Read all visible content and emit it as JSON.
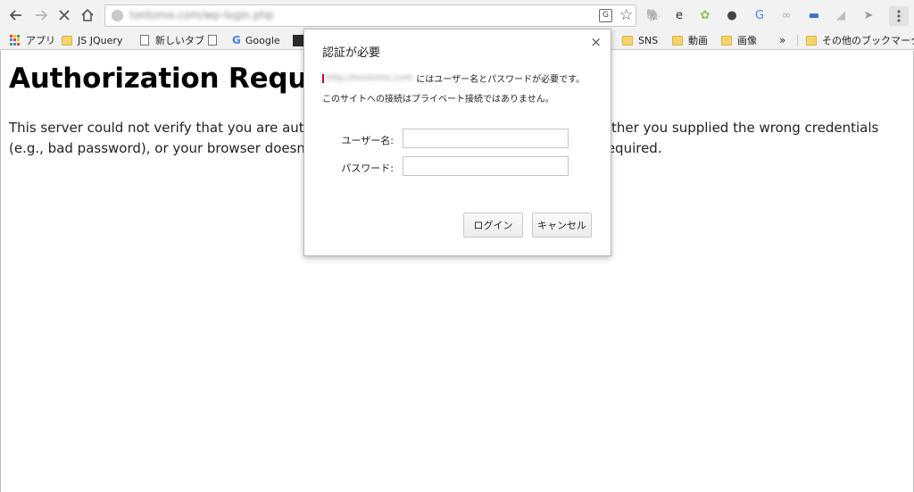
{
  "browser": {
    "url": "tontomo.com/wp-login.php",
    "colors": {
      "toolbar": "#f2f2f2",
      "folder": "#f6d36b"
    },
    "icons": [
      "back-icon",
      "forward-icon",
      "stop-icon",
      "home-icon",
      "translate-icon",
      "star-icon",
      "menu-icon"
    ],
    "translate_glyph": "G",
    "extensions": [
      {
        "name": "evernote-icon",
        "glyph": "🐘",
        "color": "#3a3a3a"
      },
      {
        "name": "e-icon",
        "glyph": "e",
        "color": "#2b2b2b"
      },
      {
        "name": "android-icon",
        "glyph": "✿",
        "color": "#8bc34a"
      },
      {
        "name": "bulb-icon",
        "glyph": "●",
        "color": "#444"
      },
      {
        "name": "google-translate-icon",
        "glyph": "G",
        "color": "#4285f4"
      },
      {
        "name": "link-icon",
        "glyph": "∞",
        "color": "#b0b0b0"
      },
      {
        "name": "chat-icon",
        "glyph": "▬",
        "color": "#3b6fd6"
      },
      {
        "name": "rss-icon",
        "glyph": "◢",
        "color": "#bdbdbd"
      },
      {
        "name": "cursor-icon",
        "glyph": "➤",
        "color": "#9a9a9a"
      }
    ]
  },
  "bookmarks": {
    "apps": "アプリ",
    "jsjquery": "JS JQuery",
    "newtab": "新しいタブ",
    "google": "Google",
    "sns": "SNS",
    "douga": "動画",
    "gazou": "画像",
    "overflow": "»",
    "other": "その他のブックマーク"
  },
  "page": {
    "title": "Authorization Required",
    "body": "This server could not verify that you are authorized to access the document requested. Either you supplied the wrong credentials (e.g., bad password), or your browser doesn't understand how to supply the credentials required."
  },
  "dialog": {
    "title": "認証が必要",
    "close": "×",
    "site": "http://tontomo.com",
    "message1": "にはユーザー名とパスワードが必要です。",
    "message2": "このサイトへの接続はプライベート接続ではありません。",
    "username_label": "ユーザー名:",
    "username_value": "",
    "password_label": "パスワード:",
    "password_value": "",
    "login_button": "ログイン",
    "cancel_button": "キャンセル"
  }
}
